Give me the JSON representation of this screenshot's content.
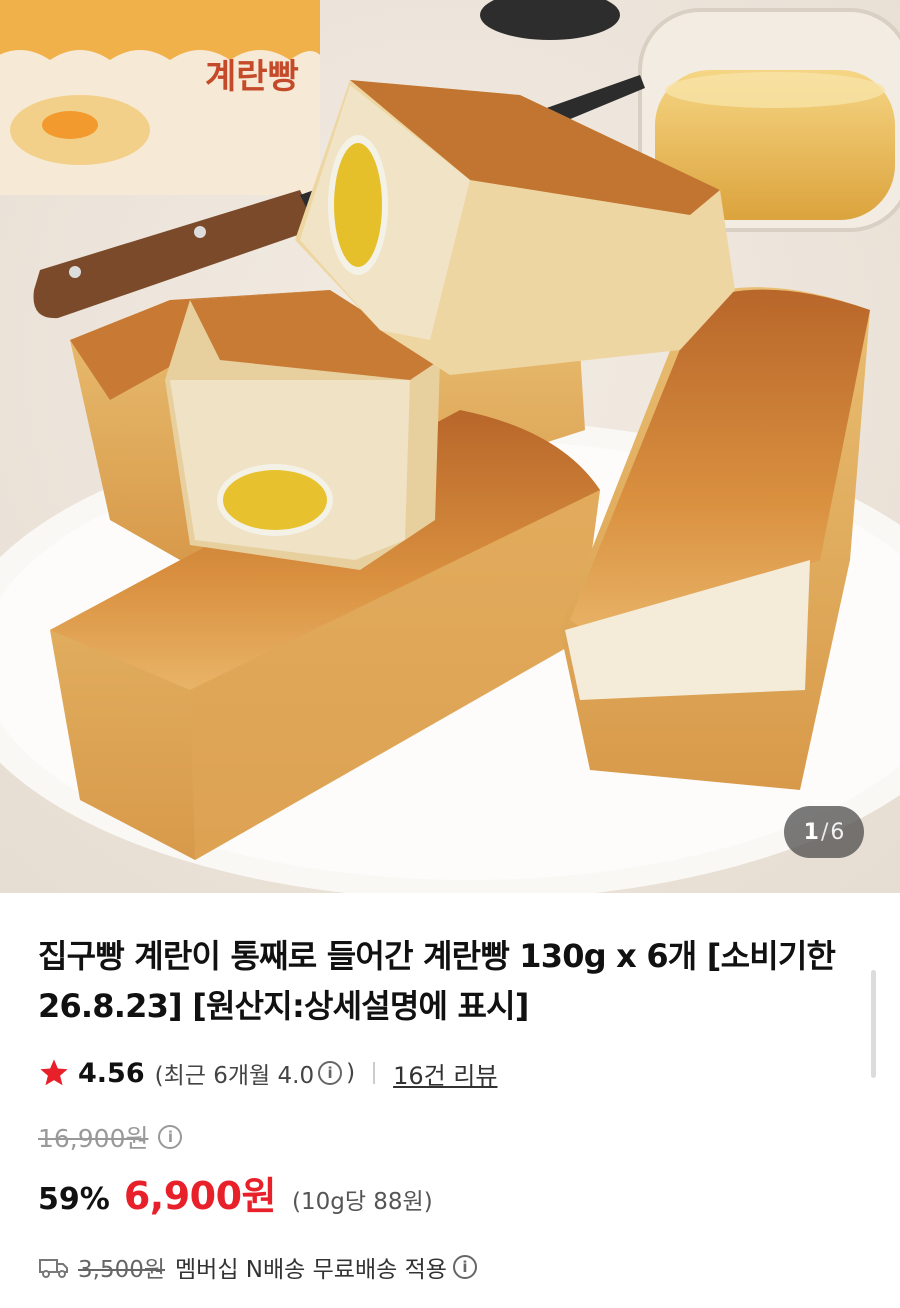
{
  "image_counter": {
    "current": "1",
    "separator": "/",
    "total": "6"
  },
  "product": {
    "title": "집구빵 계란이 통째로 들어간 계란빵 130g x 6개 [소비기한 26.8.23] [원산지:상세설명에 표시]",
    "rating": "4.56",
    "recent_rating_open": "(최근 6개월 4.0",
    "recent_rating_close": ")",
    "review_link": "16건 리뷰",
    "original_price": "16,900원",
    "discount": "59%",
    "price": "6,900원",
    "unit_price": "(10g당 88원)",
    "shipping_original": "3,500원",
    "shipping_text": "멤버십 N배송 무료배송 적용"
  },
  "package_text": "계란빵",
  "icons": {
    "star": "star-icon",
    "info": "info-icon",
    "shipping": "truck-icon"
  },
  "colors": {
    "accent_price": "#e8202a",
    "star": "#e8202a",
    "counter_bg": "#464646"
  }
}
